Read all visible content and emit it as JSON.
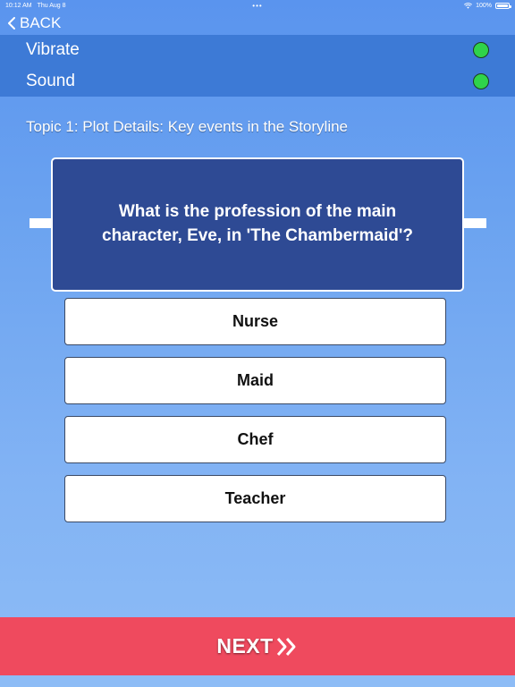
{
  "status_bar": {
    "time": "10:12 AM",
    "date": "Thu Aug 8",
    "dots": "•••",
    "battery": "100%",
    "wifi_icon": "wifi-icon",
    "battery_icon": "battery-icon"
  },
  "nav": {
    "back_label": "BACK",
    "back_icon": "chevron-left-icon"
  },
  "settings": {
    "vibrate_label": "Vibrate",
    "vibrate_on": true,
    "sound_label": "Sound",
    "sound_on": true,
    "toggle_on_color": "#2fd34a"
  },
  "topic": "Topic 1: Plot Details: Key events in the Storyline",
  "question": "What is the profession of the main character, Eve, in 'The Chambermaid'?",
  "answers": [
    "Nurse",
    "Maid",
    "Chef",
    "Teacher"
  ],
  "next": {
    "label": "NEXT",
    "icon": "double-chevron-right-icon"
  },
  "colors": {
    "background": "#6aa2f0",
    "settings_panel": "#3d7ad6",
    "question_card": "#2e4a94",
    "next_bar": "#ef4a5e"
  }
}
